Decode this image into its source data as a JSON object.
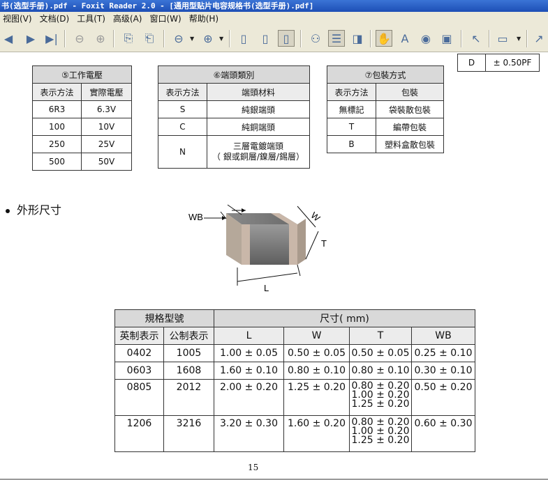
{
  "window": {
    "title": "书(选型手册).pdf - Foxit Reader 2.0 - [通用型贴片电容规格书(选型手册).pdf]"
  },
  "menu": [
    "视图(V)",
    "文档(D)",
    "工具(T)",
    "高级(A)",
    "窗口(W)",
    "帮助(H)"
  ],
  "toolbar_icons": [
    "first-page-icon",
    "prev-page-icon",
    "next-page-icon",
    "last-page-icon",
    "back-icon",
    "forward-icon",
    "rotate-left-icon",
    "rotate-right-icon",
    "zoom-out-icon",
    "zoom-in-icon",
    "single-page-icon",
    "continuous-icon",
    "facing-icon",
    "find-icon",
    "bookmarks-icon",
    "thumbnails-icon",
    "hand-tool-icon",
    "text-select-icon",
    "snapshot-icon",
    "image-tool-icon",
    "select-arrow-icon",
    "annotate-icon",
    "arrow-tool-icon"
  ],
  "toptable": {
    "col1": "D",
    "col2": "± 0.50PF"
  },
  "voltage": {
    "title": "⑤工作電壓",
    "headers": [
      "表示方法",
      "實際電壓"
    ],
    "rows": [
      [
        "6R3",
        "6.3V"
      ],
      [
        "100",
        "10V"
      ],
      [
        "250",
        "25V"
      ],
      [
        "500",
        "50V"
      ]
    ]
  },
  "terminal": {
    "title": "⑥端頭類別",
    "headers": [
      "表示方法",
      "端頭材料"
    ],
    "rows": [
      [
        "S",
        "純銀端頭"
      ],
      [
        "C",
        "純銅端頭"
      ]
    ],
    "row_n": {
      "code": "N",
      "line1": "三層電鍍端頭",
      "line2": "（ 銀或銅層/鎳層/錫層）"
    }
  },
  "packaging": {
    "title": "⑦包裝方式",
    "headers": [
      "表示方法",
      "包裝"
    ],
    "rows": [
      [
        "無標記",
        "袋裝散包裝"
      ],
      [
        "T",
        "編帶包裝"
      ],
      [
        "B",
        "塑料盒散包裝"
      ]
    ]
  },
  "dimensions_title": "外形尺寸",
  "chip_labels": {
    "wb": "WB",
    "w": "W",
    "t": "T",
    "l": "L"
  },
  "dimtable": {
    "spec_header": "規格型號",
    "size_header": "尺寸(  mm)",
    "sub_headers": [
      "英制表示",
      "公制表示",
      "L",
      "W",
      "T",
      "WB"
    ],
    "rows": [
      {
        "imp": "0402",
        "met": "1005",
        "l": "1.00 ± 0.05",
        "w": "0.50 ± 0.05",
        "t": [
          "0.50 ± 0.05"
        ],
        "wb": "0.25 ± 0.10"
      },
      {
        "imp": "0603",
        "met": "1608",
        "l": "1.60 ± 0.10",
        "w": "0.80 ± 0.10",
        "t": [
          "0.80 ± 0.10"
        ],
        "wb": "0.30 ± 0.10"
      },
      {
        "imp": "0805",
        "met": "2012",
        "l": "2.00 ± 0.20",
        "w": "1.25 ± 0.20",
        "t": [
          "0.80 ± 0.20",
          "1.00 ± 0.20",
          "1.25 ± 0.20"
        ],
        "wb": "0.50 ± 0.20"
      },
      {
        "imp": "1206",
        "met": "3216",
        "l": "3.20 ± 0.30",
        "w": "1.60 ± 0.20",
        "t": [
          "0.80 ± 0.20",
          "1.00 ± 0.20",
          "1.25 ± 0.20"
        ],
        "wb": "0.60 ± 0.30"
      }
    ]
  },
  "page_number": "15"
}
